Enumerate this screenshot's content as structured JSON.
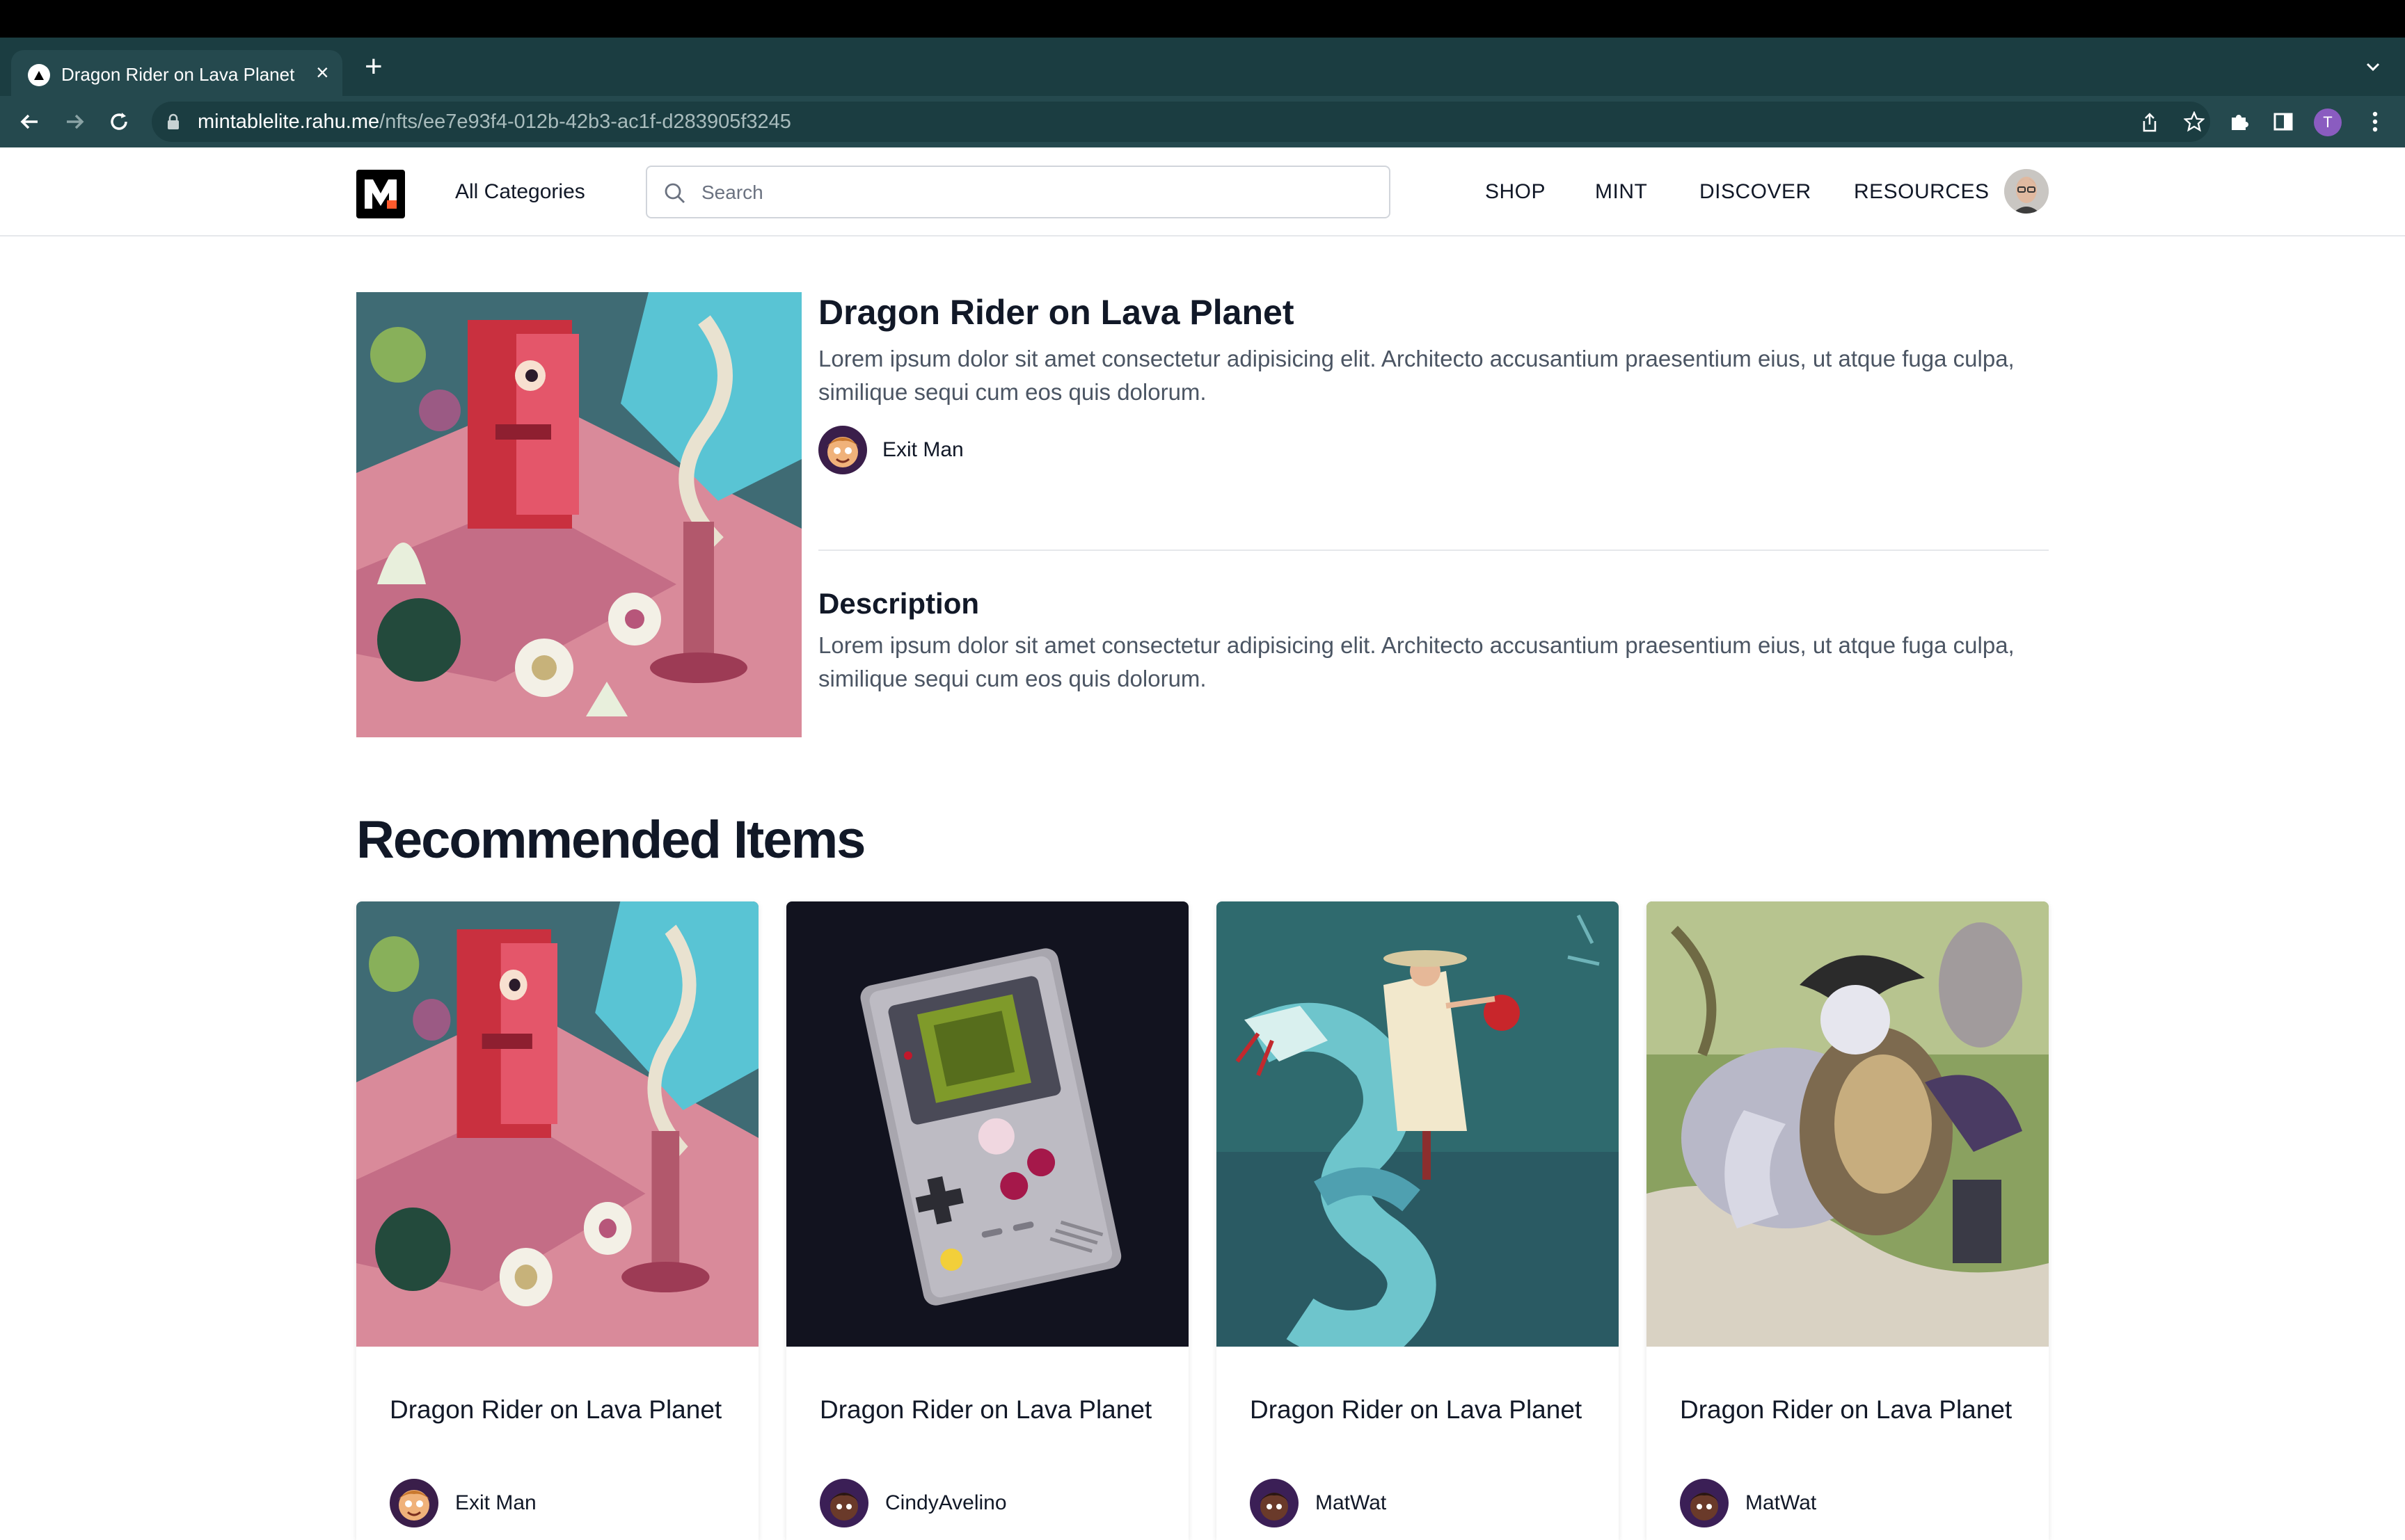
{
  "browser": {
    "tab_title": "Dragon Rider on Lava Planet",
    "close_glyph": "×",
    "new_tab_glyph": "+",
    "url_host": "mintablelite.rahu.me",
    "url_path": "/nfts/ee7e93f4-012b-42b3-ac1f-d283905f3245",
    "profile_initial": "T"
  },
  "header": {
    "categories_label": "All Categories",
    "search_placeholder": "Search",
    "nav": [
      "SHOP",
      "MINT",
      "DISCOVER",
      "RESOURCES"
    ]
  },
  "product": {
    "title": "Dragon Rider on Lava Planet",
    "summary": "Lorem ipsum dolor sit amet consectetur adipisicing elit. Architecto accusantium praesentium eius, ut atque fuga culpa, similique sequi cum eos quis dolorum.",
    "creator": "Exit Man",
    "description_heading": "Description",
    "description": "Lorem ipsum dolor sit amet consectetur adipisicing elit. Architecto accusantium praesentium eius, ut atque fuga culpa, similique sequi cum eos quis dolorum."
  },
  "recommended": {
    "heading": "Recommended Items",
    "items": [
      {
        "title": "Dragon Rider on Lava Planet",
        "creator": "Exit Man"
      },
      {
        "title": "Dragon Rider on Lava Planet",
        "creator": "CindyAvelino"
      },
      {
        "title": "Dragon Rider on Lava Planet",
        "creator": "MatWat"
      },
      {
        "title": "Dragon Rider on Lava Planet",
        "creator": "MatWat"
      }
    ]
  },
  "colors": {
    "tab_strip": "#1b3d41",
    "toolbar": "#25494e",
    "heading": "#111827",
    "body_text": "#4b5563"
  }
}
